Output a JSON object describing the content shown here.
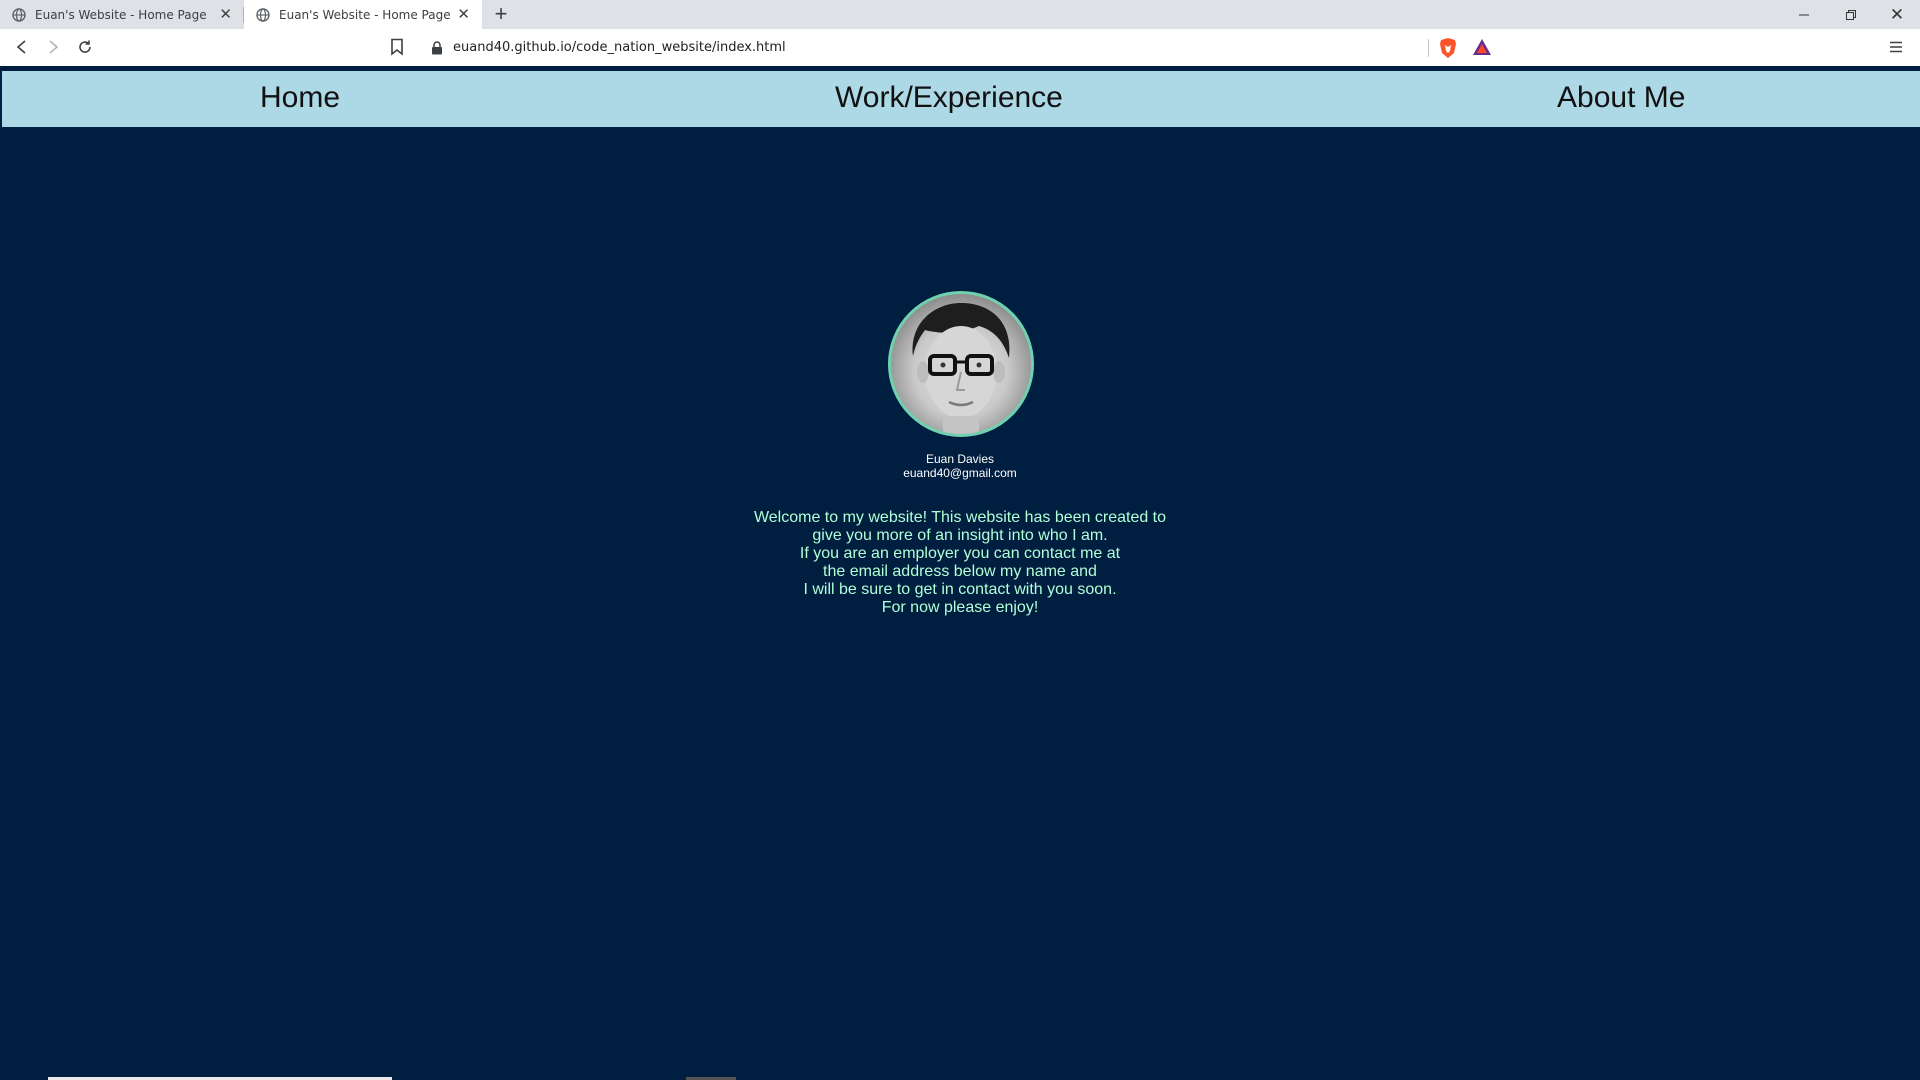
{
  "browser": {
    "tabs": [
      {
        "title": "Euan's Website - Home Page",
        "active": false
      },
      {
        "title": "Euan's Website - Home Page",
        "active": true
      }
    ],
    "url": "euand40.github.io/code_nation_website/index.html",
    "icons": {
      "back": "back-arrow-icon",
      "forward": "forward-arrow-icon",
      "reload": "reload-icon",
      "bookmark": "bookmark-icon",
      "lock": "lock-icon",
      "brave": "brave-shield-icon",
      "rewards": "brave-rewards-icon",
      "menu": "hamburger-menu-icon"
    }
  },
  "site": {
    "nav": {
      "home": "Home",
      "work": "Work/Experience",
      "about": "About Me"
    },
    "profile": {
      "name": "Euan Davies",
      "email": "euand40@gmail.com"
    },
    "welcome": [
      "Welcome to my website! This website has been created to",
      "give you more of an insight into who I am.",
      "If you are an employer you can contact me at",
      "the email address below my name and",
      "I will be sure to get in contact with you soon.",
      "For now please enjoy!"
    ],
    "colors": {
      "background": "#001e3f",
      "nav_background": "#add8e6",
      "welcome_text": "#b0ffd6",
      "avatar_border": "#6fd1b0"
    }
  }
}
